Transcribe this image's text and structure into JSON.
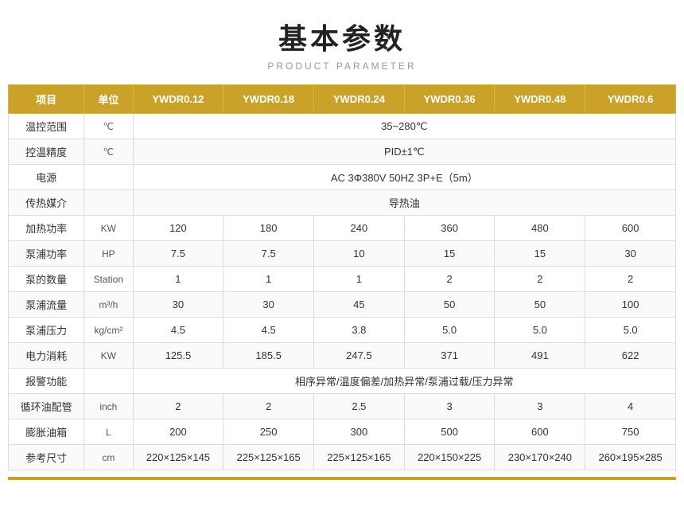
{
  "header": {
    "title": "基本参数",
    "subtitle": "PRODUCT PARAMETER"
  },
  "table": {
    "columns": [
      {
        "key": "item",
        "label": "项目"
      },
      {
        "key": "unit",
        "label": "单位"
      },
      {
        "key": "ywdr012",
        "label": "YWDR0.12"
      },
      {
        "key": "ywdr018",
        "label": "YWDR0.18"
      },
      {
        "key": "ywdr024",
        "label": "YWDR0.24"
      },
      {
        "key": "ywdr036",
        "label": "YWDR0.36"
      },
      {
        "key": "ywdr048",
        "label": "YWDR0.48"
      },
      {
        "key": "ywdr06",
        "label": "YWDR0.6"
      }
    ],
    "rows": [
      {
        "item": "温控范围",
        "unit": "℃",
        "span": true,
        "spanValue": "35~280℃"
      },
      {
        "item": "控温精度",
        "unit": "℃",
        "span": true,
        "spanValue": "PID±1℃"
      },
      {
        "item": "电源",
        "unit": "",
        "span": true,
        "spanValue": "AC 3Φ380V 50HZ 3P+E（5m）"
      },
      {
        "item": "传热媒介",
        "unit": "",
        "span": true,
        "spanValue": "导热油"
      },
      {
        "item": "加热功率",
        "unit": "KW",
        "span": false,
        "values": [
          "120",
          "180",
          "240",
          "360",
          "480",
          "600"
        ]
      },
      {
        "item": "泵浦功率",
        "unit": "HP",
        "span": false,
        "values": [
          "7.5",
          "7.5",
          "10",
          "15",
          "15",
          "30"
        ]
      },
      {
        "item": "泵的数量",
        "unit": "Station",
        "span": false,
        "values": [
          "1",
          "1",
          "1",
          "2",
          "2",
          "2"
        ]
      },
      {
        "item": "泵浦流量",
        "unit": "m³/h",
        "span": false,
        "values": [
          "30",
          "30",
          "45",
          "50",
          "50",
          "100"
        ]
      },
      {
        "item": "泵浦压力",
        "unit": "kg/cm²",
        "span": false,
        "values": [
          "4.5",
          "4.5",
          "3.8",
          "5.0",
          "5.0",
          "5.0"
        ]
      },
      {
        "item": "电力消耗",
        "unit": "KW",
        "span": false,
        "values": [
          "125.5",
          "185.5",
          "247.5",
          "371",
          "491",
          "622"
        ]
      },
      {
        "item": "报警功能",
        "unit": "",
        "span": true,
        "spanValue": "相序异常/温度偏差/加热异常/泵浦过载/压力异常"
      },
      {
        "item": "循环油配管",
        "unit": "inch",
        "span": false,
        "values": [
          "2",
          "2",
          "2.5",
          "3",
          "3",
          "4"
        ]
      },
      {
        "item": "膨胀油箱",
        "unit": "L",
        "span": false,
        "values": [
          "200",
          "250",
          "300",
          "500",
          "600",
          "750"
        ]
      },
      {
        "item": "参考尺寸",
        "unit": "cm",
        "span": false,
        "values": [
          "220×125×145",
          "225×125×165",
          "225×125×165",
          "220×150×225",
          "230×170×240",
          "260×195×285"
        ]
      }
    ]
  }
}
